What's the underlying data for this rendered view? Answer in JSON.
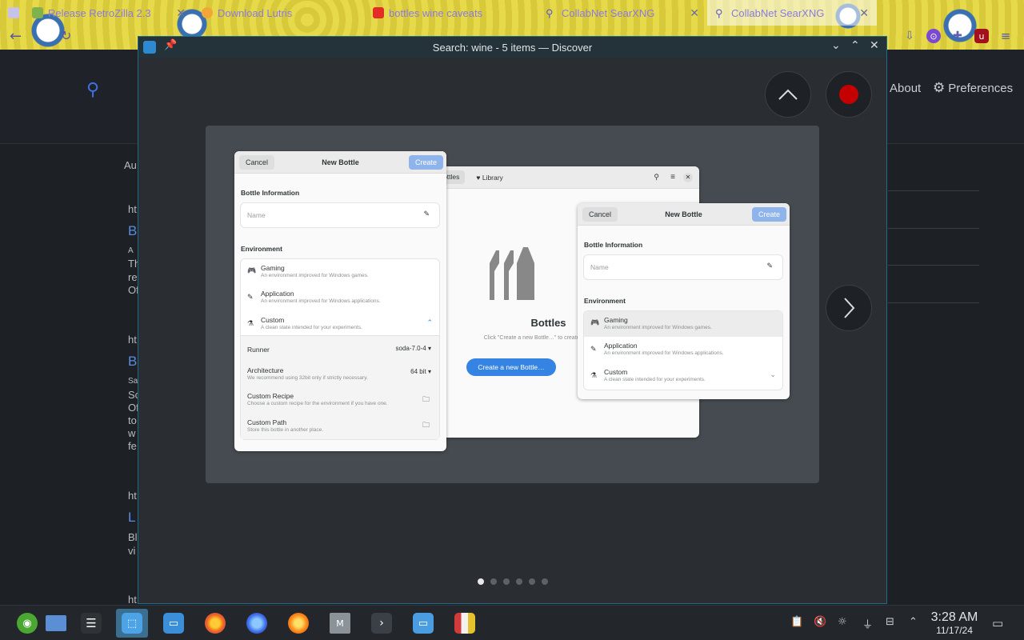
{
  "browser": {
    "tabs": [
      {
        "title": "Release RetroZilla 2.3",
        "icon_color": "#7fb24a"
      },
      {
        "title": "Download Lutris",
        "icon_color": "#f2a63a"
      },
      {
        "title": "bottles wine caveats",
        "icon_color": "#e52d27"
      },
      {
        "title": "CollabNet SearXNG",
        "icon_color": "#5b5bd0"
      },
      {
        "title": "CollabNet SearXNG",
        "icon_color": "#5b5bd0"
      }
    ],
    "back_glyph": "←",
    "reload_glyph": "↻"
  },
  "page": {
    "about": "About",
    "preferences": "Preferences",
    "fragments": [
      "Au",
      "ht",
      "B",
      "A",
      "Th",
      "re",
      "Of",
      "ht",
      "B",
      "Sa",
      "Sc",
      "Of",
      "to",
      "w",
      "fe",
      "ht",
      "L",
      "Bl",
      "vi",
      "ht"
    ]
  },
  "window": {
    "title": "Search: wine - 5 items — Discover",
    "min": "⌄",
    "max": "⌃",
    "close": "✕"
  },
  "screenshot": {
    "left_dialog": {
      "cancel": "Cancel",
      "title": "New Bottle",
      "create": "Create",
      "section_info": "Bottle Information",
      "name_placeholder": "Name",
      "section_env": "Environment",
      "env_items": [
        {
          "label": "Gaming",
          "sub": "An environment improved for Windows games."
        },
        {
          "label": "Application",
          "sub": "An environment improved for Windows applications."
        },
        {
          "label": "Custom",
          "sub": "A clean state intended for your experiments."
        }
      ],
      "runner_label": "Runner",
      "runner_value": "soda-7.0-4",
      "arch_label": "Architecture",
      "arch_sub": "We recommend using 32bit only if strictly necessary.",
      "arch_value": "64 bit",
      "recipe_label": "Custom Recipe",
      "recipe_sub": "Choose a custom recipe for the environment if you have one.",
      "path_label": "Custom Path",
      "path_sub": "Store this bottle in another place."
    },
    "main_app": {
      "tab_bottles": "Bottles",
      "tab_library": "Library",
      "app_name": "Bottles",
      "hint": "Click \"Create a new Bottle…\" to create a new bottle.",
      "cta": "Create a new Bottle…"
    },
    "right_dialog": {
      "cancel": "Cancel",
      "title": "New Bottle",
      "create": "Create",
      "section_info": "Bottle Information",
      "name_placeholder": "Name",
      "section_env": "Environment",
      "env_items": [
        {
          "label": "Gaming",
          "sub": "An environment improved for Windows games."
        },
        {
          "label": "Application",
          "sub": "An environment improved for Windows applications."
        },
        {
          "label": "Custom",
          "sub": "A clean state intended for your experiments."
        }
      ]
    }
  },
  "carousel": {
    "count": 6,
    "active_index": 0
  },
  "taskbar": {
    "time": "3:28 AM",
    "date": "11/17/24"
  },
  "colors": {
    "accent": "#3584e4",
    "window_border": "#1e6a8a",
    "record": "#c40000"
  }
}
